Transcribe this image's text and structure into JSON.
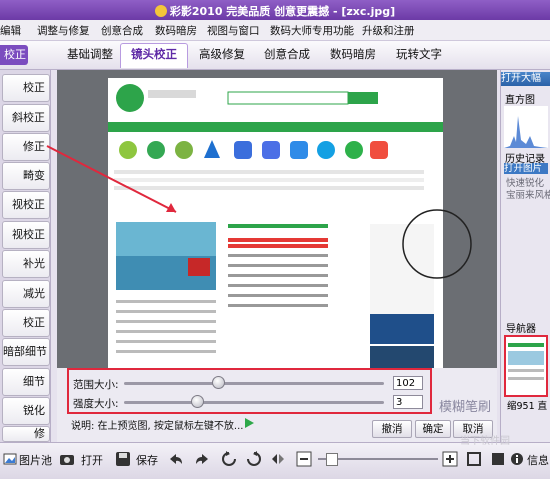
{
  "titlebar": {
    "title": "彩影2010 完美品质 创意更震撼 - [zxc.jpg]"
  },
  "menu": {
    "items": [
      "编辑",
      "调整与修复",
      "创意合成",
      "数码暗房",
      "视图与窗口",
      "数码大师专用功能",
      "升级和注册"
    ]
  },
  "left_tag": "校正",
  "tabs": [
    "基础调整",
    "镜头校正",
    "高级修复",
    "创意合成",
    "数码暗房",
    "玩转文字"
  ],
  "active_tab": "镜头校正",
  "sidebar": {
    "items": [
      "校正",
      "斜校正",
      "修正",
      "畸变",
      "视校正",
      "视校正",
      "补光",
      "减光",
      "校正",
      "暗部细节",
      "细节",
      "锐化",
      "修"
    ]
  },
  "right_panel": {
    "open_recent": "打开大幅",
    "histogram": "直方图",
    "history_title": "历史记录",
    "history_items": [
      "打开图片",
      "快速锐化",
      "宝丽来风格"
    ],
    "navigator": "导航器",
    "zoom_text": "缩951 直"
  },
  "controls": {
    "range_label": "范围大小:",
    "range_value": "102",
    "range_fraction": 0.36,
    "strength_label": "强度大小:",
    "strength_value": "3",
    "strength_fraction": 0.28,
    "tool_name": "模糊笔刷",
    "hint": "说明: 在上预览图, 按定鼠标左键不放...",
    "buttons": {
      "undo": "撤消",
      "ok": "确定",
      "cancel": "取消"
    }
  },
  "bottombar": {
    "gallery": "图片池",
    "open": "打开",
    "save": "保存",
    "info": "信息"
  },
  "watermark": "当下软件园",
  "colors": {
    "accent": "#6c3aa6",
    "highlight": "#e0283d",
    "link_blue": "#2b62a8"
  }
}
